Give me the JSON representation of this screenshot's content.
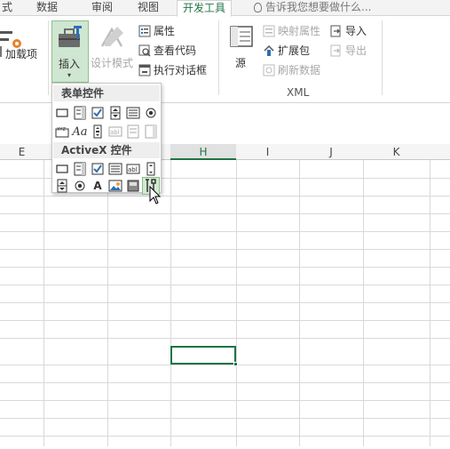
{
  "tabs": [
    {
      "label": "式"
    },
    {
      "label": "数据"
    },
    {
      "label": "审阅"
    },
    {
      "label": "视图"
    },
    {
      "label": "开发工具"
    }
  ],
  "tell_me": "告诉我您想要做什么...",
  "ribbon": {
    "addins_label": "加载项",
    "insert_label": "插入",
    "design_mode_label": "设计模式",
    "properties_label": "属性",
    "view_code_label": "查看代码",
    "run_dialog_label": "执行对话框",
    "source_label": "源",
    "map_properties_label": "映射属性",
    "expansion_packs_label": "扩展包",
    "refresh_data_label": "刷新数据",
    "import_label": "导入",
    "export_label": "导出",
    "xml_group_label": "XML"
  },
  "dropdown": {
    "form_controls_title": "表单控件",
    "activex_title": "ActiveX 控件",
    "form_icons": [
      "button",
      "combo-box",
      "check-box",
      "spin-button",
      "list-box",
      "option-button",
      "group-box",
      "label",
      "scroll-bar",
      "text-field",
      "combo-list-edit",
      "combo-dropdown-edit"
    ],
    "activex_icons": [
      "command-button",
      "combo-box",
      "check-box",
      "list-box",
      "text-box",
      "scroll-bar",
      "spin-button",
      "option-button",
      "label",
      "image",
      "toggle-button",
      "more-controls"
    ]
  },
  "sheet": {
    "columns": [
      "E",
      "",
      "",
      "H",
      "I",
      "J",
      "K"
    ],
    "selected_column": "H"
  },
  "colors": {
    "accent": "#217346",
    "hover": "#d5e8d4"
  }
}
